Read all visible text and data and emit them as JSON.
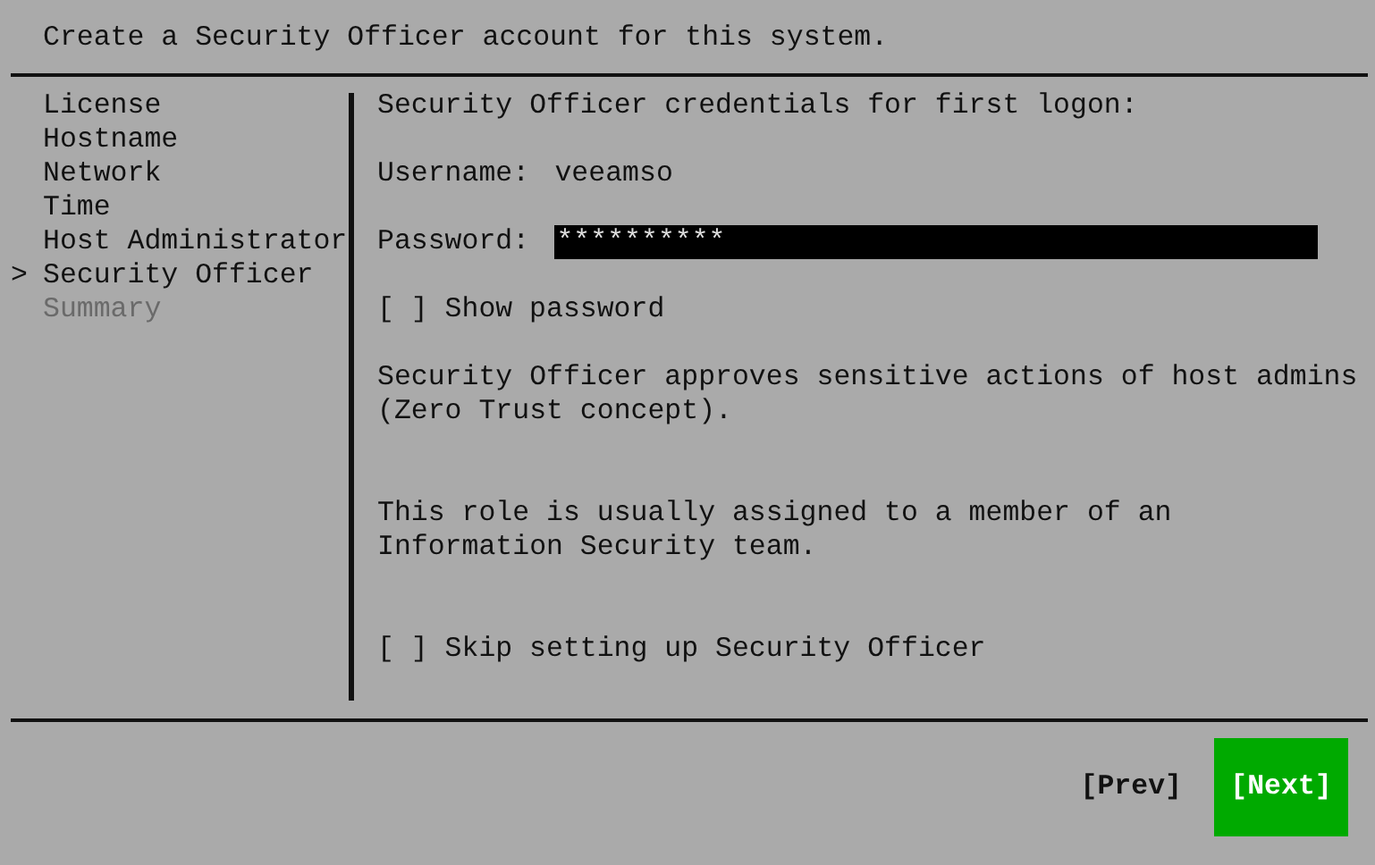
{
  "header": {
    "title": "Create a Security Officer account for this system."
  },
  "sidebar": {
    "marker": ">",
    "items": [
      {
        "label": "License",
        "selected": false,
        "disabled": false
      },
      {
        "label": "Hostname",
        "selected": false,
        "disabled": false
      },
      {
        "label": "Network",
        "selected": false,
        "disabled": false
      },
      {
        "label": "Time",
        "selected": false,
        "disabled": false
      },
      {
        "label": "Host Administrator",
        "selected": false,
        "disabled": false
      },
      {
        "label": "Security Officer",
        "selected": true,
        "disabled": false
      },
      {
        "label": "Summary",
        "selected": false,
        "disabled": true
      }
    ]
  },
  "content": {
    "heading": "Security Officer credentials for first logon:",
    "username": {
      "label": "Username:",
      "value": "veeamso"
    },
    "password": {
      "label": "Password:",
      "value": "**********"
    },
    "show_password": {
      "box": "[ ]",
      "label": "Show password",
      "checked": false
    },
    "paragraphs": [
      "Security Officer approves sensitive actions of host admins (Zero Trust concept).",
      "This role is usually assigned to a member of an Information Security team."
    ],
    "skip": {
      "box": "[ ]",
      "label": "Skip setting up Security Officer",
      "checked": false
    }
  },
  "buttons": [
    {
      "label": "[Prev]",
      "selected": false
    },
    {
      "label": "[Next]",
      "selected": true
    }
  ]
}
